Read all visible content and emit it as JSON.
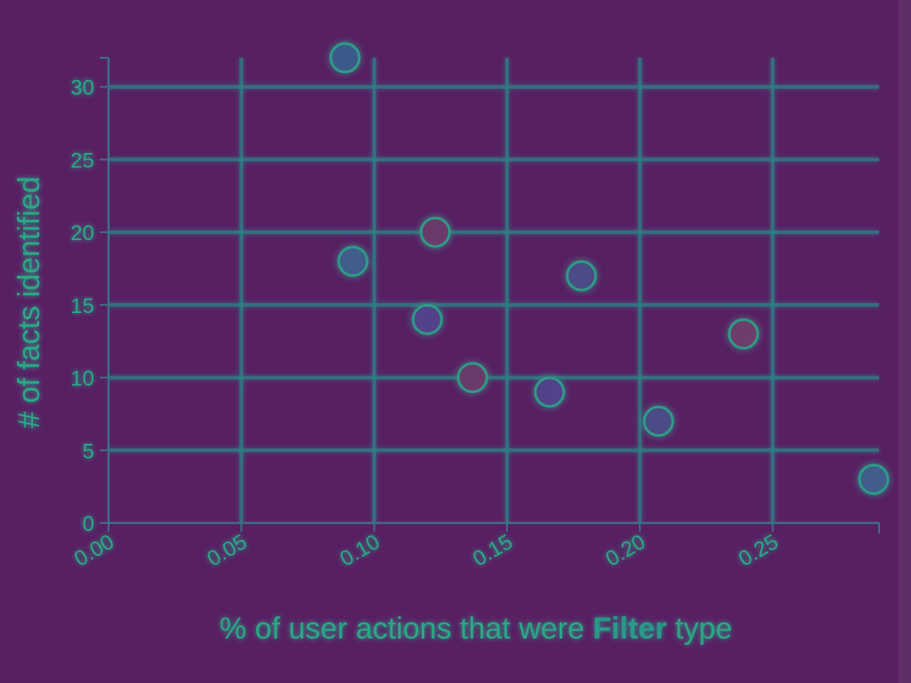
{
  "chart_data": {
    "type": "scatter",
    "xlabel": {
      "prefix": "% of user actions that were ",
      "emphasis": "Filter",
      "suffix": " type"
    },
    "ylabel": "# of facts identified",
    "xlim": [
      0,
      0.29
    ],
    "ylim": [
      0,
      32
    ],
    "x_ticks": [
      0.0,
      0.05,
      0.1,
      0.15,
      0.2,
      0.25
    ],
    "x_tick_labels": [
      "0.00",
      "0.05",
      "0.10",
      "0.15",
      "0.20",
      "0.25"
    ],
    "y_ticks": [
      0,
      5,
      10,
      15,
      20,
      25,
      30
    ],
    "y_tick_labels": [
      "0",
      "5",
      "10",
      "15",
      "20",
      "25",
      "30"
    ],
    "grid": true,
    "points": [
      {
        "x": 0.089,
        "y": 32,
        "color": "#3a5a8a"
      },
      {
        "x": 0.092,
        "y": 18,
        "color": "#3f5d8c"
      },
      {
        "x": 0.12,
        "y": 14,
        "color": "#53438a"
      },
      {
        "x": 0.123,
        "y": 20,
        "color": "#6b3a6a"
      },
      {
        "x": 0.137,
        "y": 10,
        "color": "#6b3a6a"
      },
      {
        "x": 0.166,
        "y": 9,
        "color": "#53438a"
      },
      {
        "x": 0.178,
        "y": 17,
        "color": "#4b4b85"
      },
      {
        "x": 0.207,
        "y": 7,
        "color": "#4b4b85"
      },
      {
        "x": 0.239,
        "y": 13,
        "color": "#6e3c6a"
      },
      {
        "x": 0.288,
        "y": 3,
        "color": "#3f5d8c"
      }
    ]
  }
}
